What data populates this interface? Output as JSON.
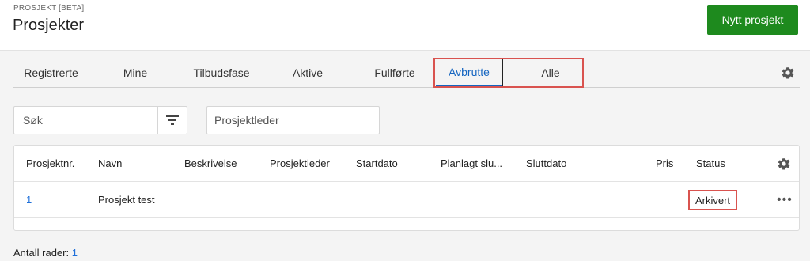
{
  "header": {
    "overline": "PROSJEKT [BETA]",
    "title": "Prosjekter",
    "new_button": "Nytt prosjekt"
  },
  "tabs": [
    {
      "label": "Registrerte",
      "active": false
    },
    {
      "label": "Mine",
      "active": false
    },
    {
      "label": "Tilbudsfase",
      "active": false
    },
    {
      "label": "Aktive",
      "active": false
    },
    {
      "label": "Fullførte",
      "active": false
    },
    {
      "label": "Avbrutte",
      "active": true
    },
    {
      "label": "Alle",
      "active": false
    }
  ],
  "filters": {
    "search_placeholder": "Søk",
    "project_leader_placeholder": "Prosjektleder"
  },
  "table": {
    "columns": [
      "Prosjektnr.",
      "Navn",
      "Beskrivelse",
      "Prosjektleder",
      "Startdato",
      "Planlagt slu...",
      "Sluttdato",
      "Pris",
      "Status"
    ],
    "rows": [
      {
        "nr": "1",
        "navn": "Prosjekt test",
        "beskrivelse": "",
        "prosjektleder": "",
        "startdato": "",
        "planlagt": "",
        "sluttdato": "",
        "pris": "",
        "status": "Arkivert"
      }
    ],
    "row_menu": "•••"
  },
  "footer": {
    "label": "Antall rader:",
    "count": "1"
  },
  "colors": {
    "primary_button": "#1e8a1e",
    "active_tab": "#1565c0",
    "link": "#1e6fd9",
    "highlight": "#d9534f"
  },
  "icons": {
    "tabs_settings": "gear-icon",
    "table_settings": "gear-icon",
    "filter": "filter-icon",
    "row_menu": "more-horizontal-icon"
  }
}
